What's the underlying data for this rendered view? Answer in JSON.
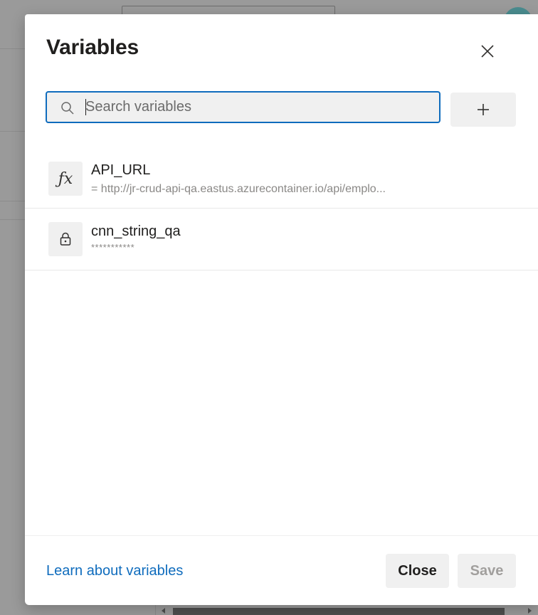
{
  "dialog": {
    "title": "Variables",
    "close_icon": "close-icon"
  },
  "search": {
    "placeholder": "Search variables",
    "value": "",
    "icon": "search-icon"
  },
  "add_button": {
    "icon": "plus-icon"
  },
  "variables": [
    {
      "name": "API_URL",
      "value": "= http://jr-crud-api-qa.eastus.azurecontainer.io/api/emplo...",
      "icon": "fx-icon"
    },
    {
      "name": "cnn_string_qa",
      "value": "***********",
      "icon": "lock-icon"
    }
  ],
  "footer": {
    "learn_link": "Learn about variables",
    "close_label": "Close",
    "save_label": "Save"
  },
  "colors": {
    "accent": "#0f6cbd",
    "button_bg": "#f0f0f0",
    "disabled_text": "#a19f9d"
  }
}
